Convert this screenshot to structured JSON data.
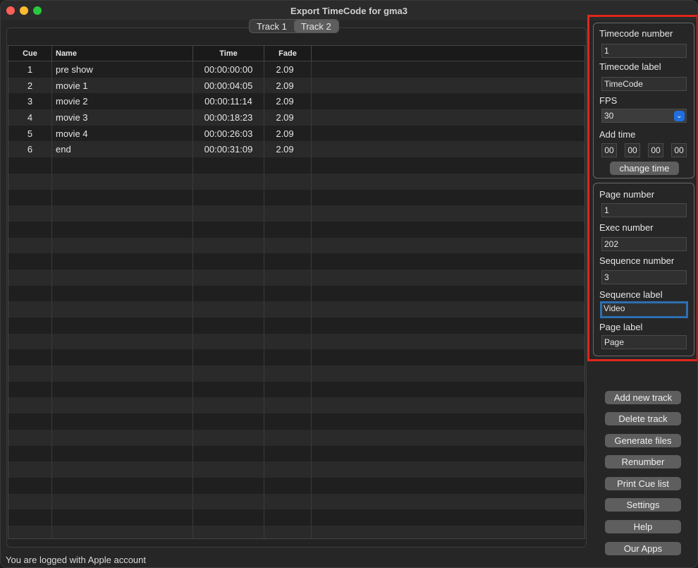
{
  "window": {
    "title": "Export TimeCode for gma3"
  },
  "tabs": [
    {
      "label": "Track 1"
    },
    {
      "label": "Track 2"
    }
  ],
  "table": {
    "headers": {
      "cue": "Cue",
      "name": "Name",
      "time": "Time",
      "fade": "Fade"
    },
    "rows": [
      {
        "cue": "1",
        "name": "pre show",
        "time": "00:00:00:00",
        "fade": "2.09"
      },
      {
        "cue": "2",
        "name": "movie 1",
        "time": "00:00:04:05",
        "fade": "2.09"
      },
      {
        "cue": "3",
        "name": "movie 2",
        "time": "00:00:11:14",
        "fade": "2.09"
      },
      {
        "cue": "4",
        "name": "movie 3",
        "time": "00:00:18:23",
        "fade": "2.09"
      },
      {
        "cue": "5",
        "name": "movie 4",
        "time": "00:00:26:03",
        "fade": "2.09"
      },
      {
        "cue": "6",
        "name": "end",
        "time": "00:00:31:09",
        "fade": "2.09"
      }
    ]
  },
  "timecode_panel": {
    "number_label": "Timecode number",
    "number_value": "1",
    "label_label": "Timecode label",
    "label_value": "TimeCode",
    "fps_label": "FPS",
    "fps_value": "30",
    "add_time_label": "Add time",
    "add_time_values": [
      "00",
      "00",
      "00",
      "00"
    ],
    "change_time_button": "change time"
  },
  "sequence_panel": {
    "page_number_label": "Page number",
    "page_number_value": "1",
    "exec_number_label": "Exec number",
    "exec_number_value": "202",
    "sequence_number_label": "Sequence number",
    "sequence_number_value": "3",
    "sequence_label_label": "Sequence label",
    "sequence_label_value": "Video",
    "page_label_label": "Page label",
    "page_label_value": "Page"
  },
  "actions": {
    "add_new_track": "Add new track",
    "delete_track": "Delete track",
    "generate_files": "Generate files",
    "renumber": "Renumber",
    "print_cue_list": "Print Cue list",
    "settings": "Settings",
    "help": "Help",
    "our_apps": "Our Apps"
  },
  "status": {
    "text": "You are logged with Apple account"
  },
  "colors": {
    "highlight": "#e0261b",
    "focus": "#2d6fb3",
    "select_chevron": "#1f6fe0"
  }
}
